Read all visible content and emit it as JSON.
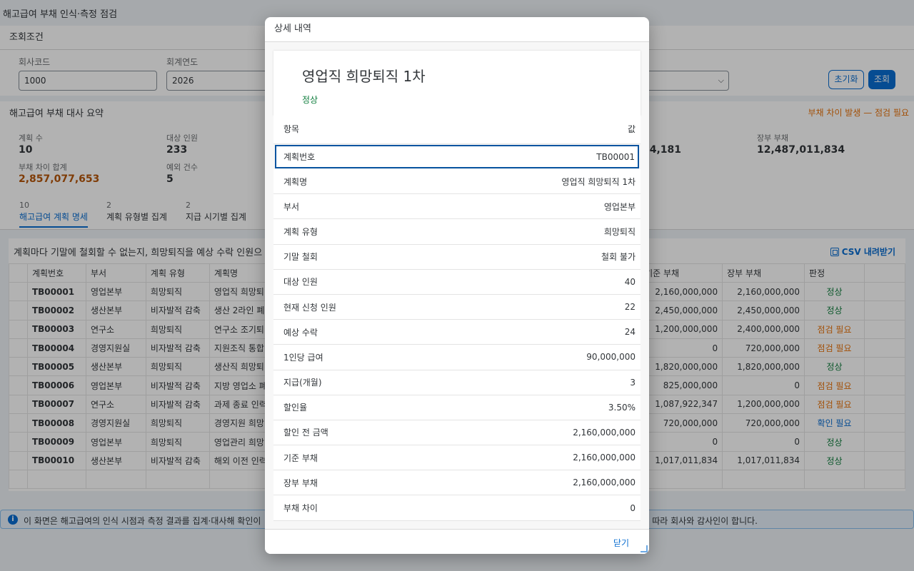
{
  "page": {
    "title": "해고급여 부채 인식·측정 점검"
  },
  "filters": {
    "section_title": "조회조건",
    "company_code_label": "회사코드",
    "company_code_value": "1000",
    "fiscal_year_label": "회계연도",
    "fiscal_year_value": "2026",
    "reset_label": "초기화",
    "search_label": "조회"
  },
  "summary": {
    "title": "해고급여 부채 대사 요약",
    "warning": "부채 차이 발생 — 점검 필요",
    "plan_count_label": "계획 수",
    "plan_count": "10",
    "target_headcount_label": "대상 인원",
    "target_headcount": "233",
    "partial_value": "34,181",
    "book_liability_label": "장부 부채",
    "book_liability": "12,487,011,834",
    "diff_total_label": "부채 차이 합계",
    "diff_total": "2,857,077,653",
    "exception_label": "예외 건수",
    "exception_count": "5"
  },
  "tabs": [
    {
      "count": "10",
      "label": "해고급여 계획 명세"
    },
    {
      "count": "2",
      "label": "계획 유형별 집계"
    },
    {
      "count": "2",
      "label": "지급 시기별 집계"
    }
  ],
  "table": {
    "description": "계획마다 기말에 철회할 수 없는지, 희망퇴직을 예상 수락 인원으",
    "csv_label": "CSV 내려받기",
    "headers": {
      "plan_no": "계획번호",
      "dept": "부서",
      "type": "계획 유형",
      "name": "계획명",
      "base": "기준 부채",
      "book": "장부 부채",
      "judgement": "판정"
    },
    "rows": [
      {
        "plan_no": "TB00001",
        "dept": "영업본부",
        "type": "희망퇴직",
        "name": "영업직 희망퇴",
        "base": "2,160,000,000",
        "book": "2,160,000,000",
        "judgement": "정상",
        "status": "ok"
      },
      {
        "plan_no": "TB00002",
        "dept": "생산본부",
        "type": "비자발적 감축",
        "name": "생산 2라인 폐",
        "base": "2,450,000,000",
        "book": "2,450,000,000",
        "judgement": "정상",
        "status": "ok"
      },
      {
        "plan_no": "TB00003",
        "dept": "연구소",
        "type": "희망퇴직",
        "name": "연구소 조기퇴",
        "base": "1,200,000,000",
        "book": "2,400,000,000",
        "judgement": "점검 필요",
        "status": "warn"
      },
      {
        "plan_no": "TB00004",
        "dept": "경영지원실",
        "type": "비자발적 감축",
        "name": "지원조직 통합",
        "base": "0",
        "book": "720,000,000",
        "judgement": "점검 필요",
        "status": "warn"
      },
      {
        "plan_no": "TB00005",
        "dept": "생산본부",
        "type": "희망퇴직",
        "name": "생산직 희망퇴",
        "base": "1,820,000,000",
        "book": "1,820,000,000",
        "judgement": "정상",
        "status": "ok"
      },
      {
        "plan_no": "TB00006",
        "dept": "영업본부",
        "type": "비자발적 감축",
        "name": "지방 영업소 폐",
        "base": "825,000,000",
        "book": "0",
        "judgement": "점검 필요",
        "status": "warn"
      },
      {
        "plan_no": "TB00007",
        "dept": "연구소",
        "type": "비자발적 감축",
        "name": "과제 종료 인력",
        "base": "1,087,922,347",
        "book": "1,200,000,000",
        "judgement": "점검 필요",
        "status": "warn"
      },
      {
        "plan_no": "TB00008",
        "dept": "경영지원실",
        "type": "희망퇴직",
        "name": "경영지원 희망",
        "base": "720,000,000",
        "book": "720,000,000",
        "judgement": "확인 필요",
        "status": "check"
      },
      {
        "plan_no": "TB00009",
        "dept": "영업본부",
        "type": "희망퇴직",
        "name": "영업관리 희망",
        "base": "0",
        "book": "0",
        "judgement": "정상",
        "status": "ok"
      },
      {
        "plan_no": "TB00010",
        "dept": "생산본부",
        "type": "비자발적 감축",
        "name": "해외 이전 인력",
        "base": "1,017,011,834",
        "book": "1,017,011,834",
        "judgement": "정상",
        "status": "ok"
      }
    ]
  },
  "info": {
    "text_left": "이 화면은 해고급여의 인식 시점과 측정 결과를 집계·대사해 확인이",
    "text_right": "따라 회사와 감사인이 합니다."
  },
  "dialog": {
    "title": "상세 내역",
    "object_title": "영업직 희망퇴직 1차",
    "object_status": "정상",
    "col_item": "항목",
    "col_value": "값",
    "rows": [
      {
        "key": "계획번호",
        "value": "TB00001"
      },
      {
        "key": "계획명",
        "value": "영업직 희망퇴직 1차"
      },
      {
        "key": "부서",
        "value": "영업본부"
      },
      {
        "key": "계획 유형",
        "value": "희망퇴직"
      },
      {
        "key": "기말 철회",
        "value": "철회 불가"
      },
      {
        "key": "대상 인원",
        "value": "40"
      },
      {
        "key": "현재 신청 인원",
        "value": "22"
      },
      {
        "key": "예상 수락",
        "value": "24"
      },
      {
        "key": "1인당 급여",
        "value": "90,000,000"
      },
      {
        "key": "지급(개월)",
        "value": "3"
      },
      {
        "key": "할인율",
        "value": "3.50%"
      },
      {
        "key": "할인 전 금액",
        "value": "2,160,000,000"
      },
      {
        "key": "기준 부채",
        "value": "2,160,000,000"
      },
      {
        "key": "장부 부채",
        "value": "2,160,000,000"
      },
      {
        "key": "부채 차이",
        "value": "0"
      }
    ],
    "close_label": "닫기"
  }
}
